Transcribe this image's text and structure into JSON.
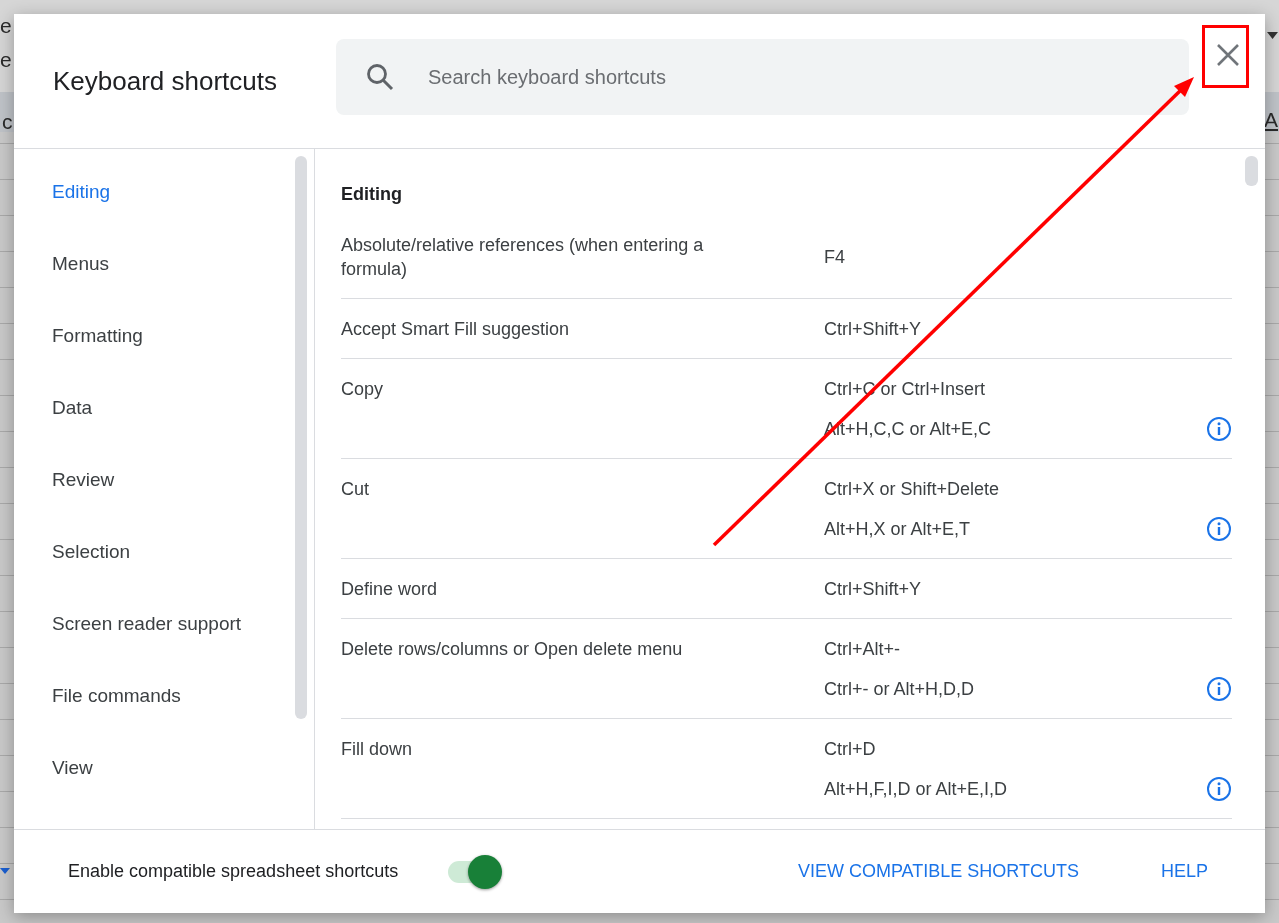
{
  "background": {
    "fragments": [
      "e",
      "e",
      "c",
      "A"
    ]
  },
  "dialog": {
    "title": "Keyboard shortcuts",
    "search": {
      "placeholder": "Search keyboard shortcuts"
    },
    "sidebar": {
      "items": [
        {
          "label": "Editing",
          "selected": true
        },
        {
          "label": "Menus",
          "selected": false
        },
        {
          "label": "Formatting",
          "selected": false
        },
        {
          "label": "Data",
          "selected": false
        },
        {
          "label": "Review",
          "selected": false
        },
        {
          "label": "Selection",
          "selected": false
        },
        {
          "label": "Screen reader support",
          "selected": false
        },
        {
          "label": "File commands",
          "selected": false
        },
        {
          "label": "View",
          "selected": false
        }
      ]
    },
    "section": {
      "heading": "Editing",
      "rows": [
        {
          "description": "Absolute/relative references (when entering a formula)",
          "keys": [
            {
              "text": "F4",
              "info": false
            }
          ]
        },
        {
          "description": "Accept Smart Fill suggestion",
          "keys": [
            {
              "text": "Ctrl+Shift+Y",
              "info": false
            }
          ]
        },
        {
          "description": "Copy",
          "keys": [
            {
              "text": "Ctrl+C or Ctrl+Insert",
              "info": false
            },
            {
              "text": "Alt+H,C,C or Alt+E,C",
              "info": true
            }
          ]
        },
        {
          "description": "Cut",
          "keys": [
            {
              "text": "Ctrl+X or Shift+Delete",
              "info": false
            },
            {
              "text": "Alt+H,X or Alt+E,T",
              "info": true
            }
          ]
        },
        {
          "description": "Define word",
          "keys": [
            {
              "text": "Ctrl+Shift+Y",
              "info": false
            }
          ]
        },
        {
          "description": "Delete rows/columns or Open delete menu",
          "keys": [
            {
              "text": "Ctrl+Alt+-",
              "info": false
            },
            {
              "text": "Ctrl+- or Alt+H,D,D",
              "info": true
            }
          ]
        },
        {
          "description": "Fill down",
          "keys": [
            {
              "text": "Ctrl+D",
              "info": false
            },
            {
              "text": "Alt+H,F,I,D or Alt+E,I,D",
              "info": true
            }
          ]
        }
      ]
    },
    "footer": {
      "toggle": {
        "label": "Enable compatible spreadsheet shortcuts",
        "on": true
      },
      "links": [
        "VIEW COMPATIBLE SHORTCUTS",
        "HELP"
      ]
    }
  }
}
